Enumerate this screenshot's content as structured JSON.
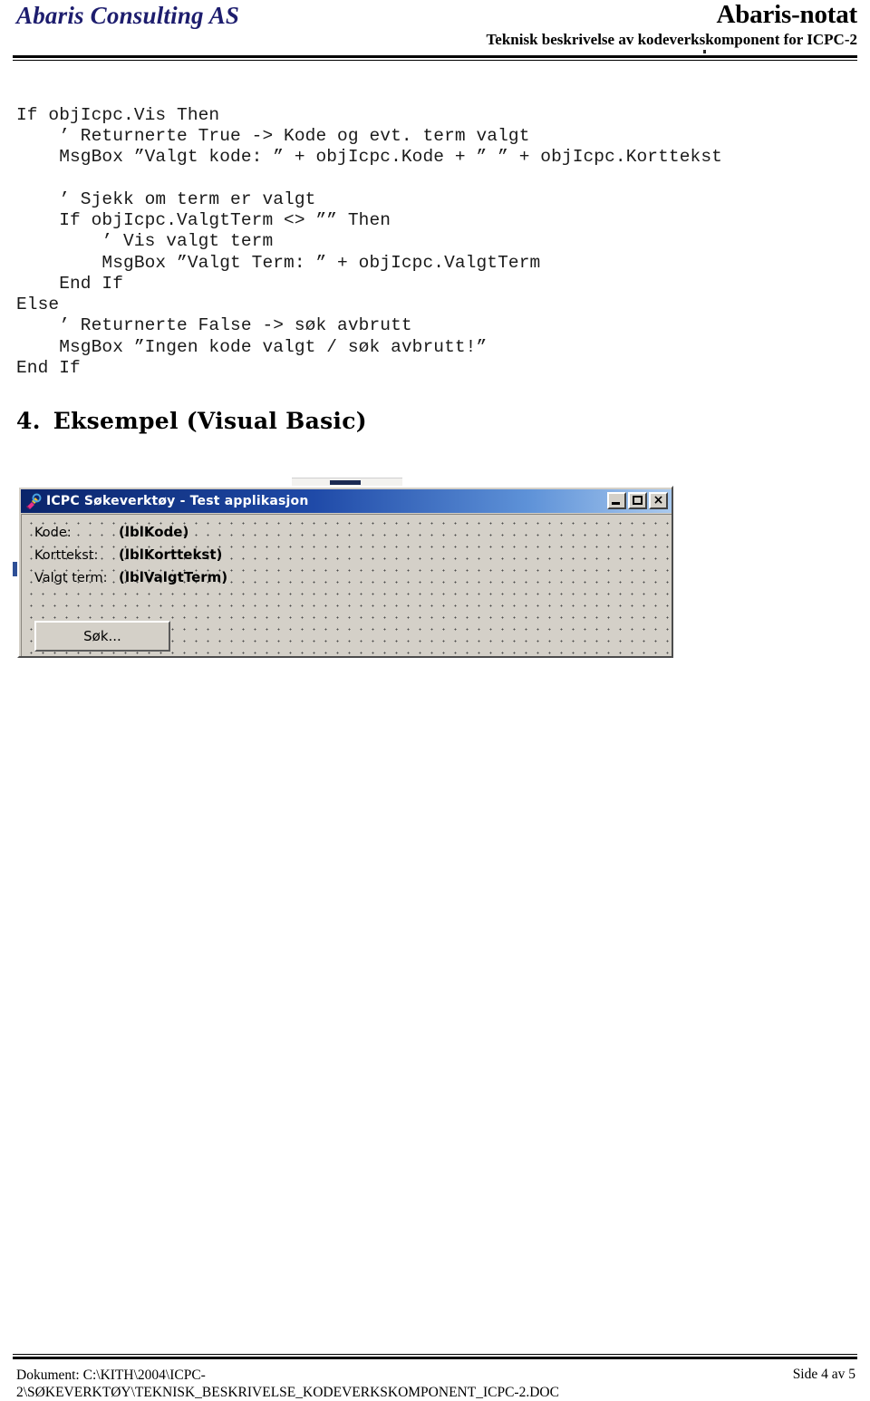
{
  "header": {
    "company": "Abaris Consulting AS",
    "doc_title": "Abaris-notat",
    "doc_subtitle": "Teknisk beskrivelse av kodeverkskomponent for ICPC-2",
    "company_color": "#1d1d6e"
  },
  "code": {
    "language": "Visual Basic",
    "text": "If objIcpc.Vis Then\n    ’ Returnerte True -> Kode og evt. term valgt\n    MsgBox ”Valgt kode: ” + objIcpc.Kode + ” ” + objIcpc.Korttekst\n\n    ’ Sjekk om term er valgt\n    If objIcpc.ValgtTerm <> ”” Then\n        ’ Vis valgt term\n        MsgBox ”Valgt Term: ” + objIcpc.ValgtTerm\n    End If\nElse\n    ’ Returnerte False -> søk avbrutt\n    MsgBox ”Ingen kode valgt / søk avbrutt!”\nEnd If"
  },
  "section": {
    "number": "4.",
    "title": "Eksempel (Visual Basic)"
  },
  "vb_form": {
    "icon": "app-icon",
    "title": "ICPC Søkeverktøy - Test applikasjon",
    "window_buttons": {
      "minimize": "minimize-icon",
      "maximize": "maximize-icon",
      "close": "×"
    },
    "rows": [
      {
        "label": "Kode:",
        "value": "(lblKode)"
      },
      {
        "label": "Korttekst:",
        "value": "(lblKorttekst)"
      },
      {
        "label": "Valgt term:",
        "value": "(lblValgtTerm)"
      }
    ],
    "search_button": "Søk...",
    "titlebar_color": "#0a246a",
    "surface_color": "#d4d0c8"
  },
  "footer": {
    "document_line1": "Dokument: C:\\KITH\\2004\\ICPC-",
    "document_line2": "2\\SØKEVERKTØY\\TEKNISK_BESKRIVELSE_KODEVERKSKOMPONENT_ICPC-2.DOC",
    "page": "Side 4 av 5"
  }
}
